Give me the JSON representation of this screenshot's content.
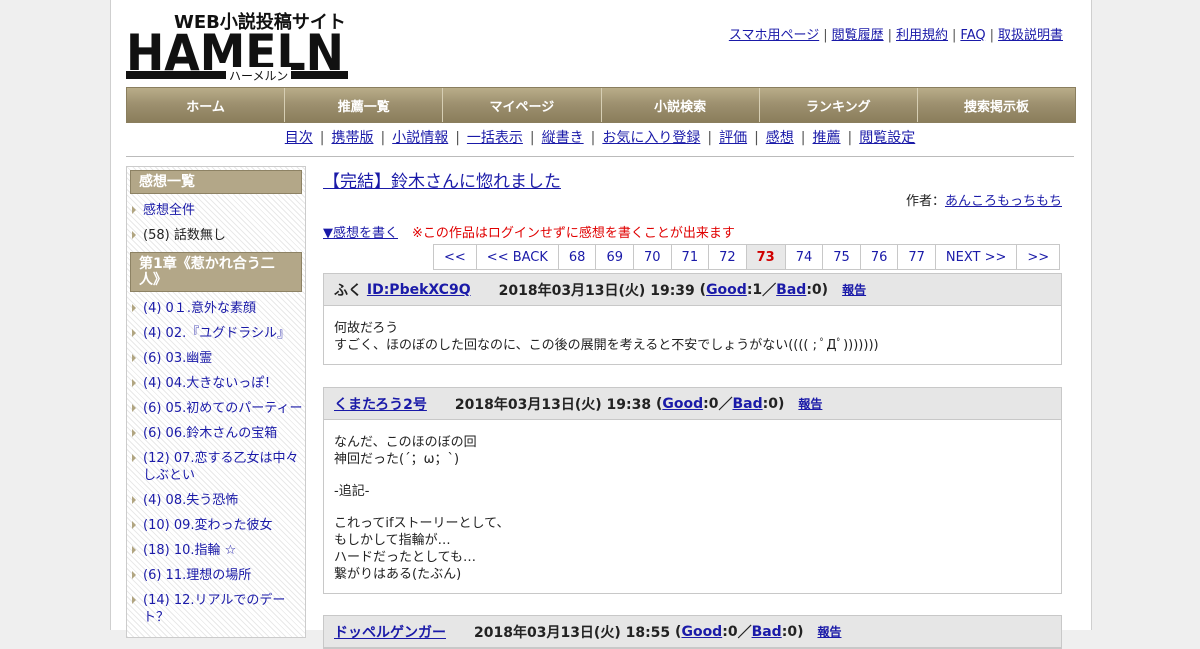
{
  "logo": {
    "tagline": "WEB小説投稿サイト",
    "brand": "HAMELN",
    "kana": "ハーメルン"
  },
  "top_links": [
    "スマホ用ページ",
    "閲覧履歴",
    "利用規約",
    "FAQ",
    "取扱説明書"
  ],
  "global_nav": [
    "ホーム",
    "推薦一覧",
    "マイページ",
    "小説検索",
    "ランキング",
    "捜索掲示板"
  ],
  "sub_nav": [
    "目次",
    "携帯版",
    "小説情報",
    "一括表示",
    "縦書き",
    "お気に入り登録",
    "評価",
    "感想",
    "推薦",
    "閲覧設定"
  ],
  "sidebar": {
    "heading": "感想一覧",
    "items": [
      "感想全件",
      "(58) 話数無し"
    ],
    "chapter": "第1章《惹かれ合う二人》",
    "chapter_items": [
      "(4) 0１.意外な素顔",
      "(4) 02.『ユグドラシル』",
      "(6) 03.幽霊",
      "(4) 04.大きないっぽ！",
      "(6) 05.初めてのパーティー",
      "(6) 06.鈴木さんの宝箱",
      "(12) 07.恋する乙女は中々しぶとい",
      "(4) 08.失う恐怖",
      "(10) 09.変わった彼女",
      "(18) 10.指輪 ☆",
      "(6) 11.理想の場所",
      "(14) 12.リアルでのデート？"
    ]
  },
  "novel": {
    "title": "【完結】鈴木さんに惚れました",
    "author_label": "作者：",
    "author": "あんころもっちもち"
  },
  "write_link": "▼感想を書く",
  "warning": "※この作品はログインせずに感想を書くことが出来ます",
  "pager": [
    "<<",
    "<< BACK",
    "68",
    "69",
    "70",
    "71",
    "72",
    "73",
    "74",
    "75",
    "76",
    "77",
    "NEXT >>",
    ">>"
  ],
  "pager_current": "73",
  "comments": [
    {
      "name": "ふく",
      "id": "ID:PbekXC9Q",
      "date": "2018年03月13日(火) 19:39",
      "good": "1",
      "bad": "0",
      "report": "報告",
      "lines": [
        "何故だろう",
        "すごく、ほのぼのした回なのに、この後の展開を考えると不安でしょうがない(((( ; ﾟДﾟ)))))))"
      ]
    },
    {
      "name": "くまたろう2号",
      "date": "2018年03月13日(火) 19:38",
      "good": "0",
      "bad": "0",
      "report": "報告",
      "para1": [
        "なんだ、このほのぼの回",
        "神回だった(´；ω；`)"
      ],
      "para2": [
        "-追記-"
      ],
      "para3": [
        "これってifストーリーとして、",
        "もしかして指輪が…",
        "ハードだったとしても…",
        "繋がりはある(たぶん)"
      ]
    },
    {
      "name": "ドッペルゲンガー",
      "date": "2018年03月13日(火) 18:55",
      "good": "0",
      "bad": "0",
      "report": "報告"
    }
  ],
  "labels": {
    "good": "Good",
    "bad": "Bad"
  }
}
